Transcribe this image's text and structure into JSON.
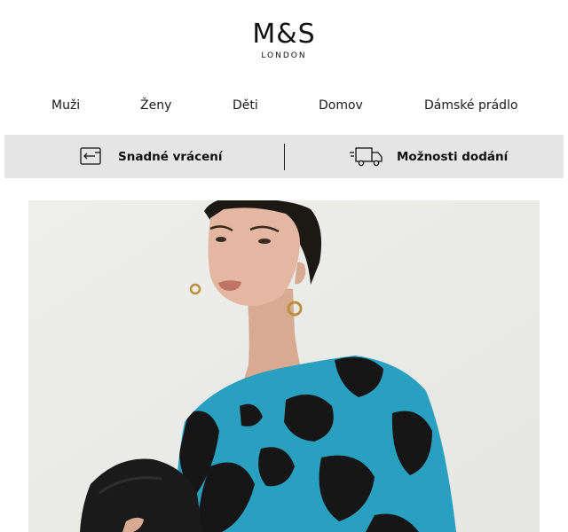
{
  "brand": {
    "logo": "M&S",
    "sub": "LONDON"
  },
  "nav": [
    {
      "label": "Muži"
    },
    {
      "label": "Ženy"
    },
    {
      "label": "Děti"
    },
    {
      "label": "Domov"
    },
    {
      "label": "Dámské prádlo"
    }
  ],
  "services": [
    {
      "label": "Snadné vrácení",
      "icon": "return-icon"
    },
    {
      "label": "Možnosti dodání",
      "icon": "truck-icon"
    }
  ],
  "hero": {
    "icon": "hero-photo",
    "dress_color": "#2aa0c0",
    "print_color": "#161616"
  }
}
